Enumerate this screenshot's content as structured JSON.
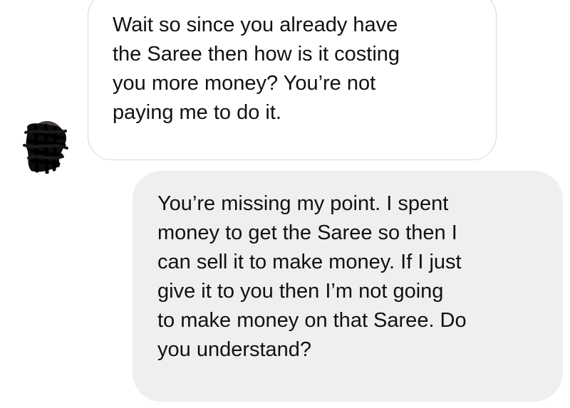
{
  "conversation": {
    "messages": [
      {
        "direction": "incoming",
        "lines": [
          "Wait so since you already have",
          "the Saree then how is it costing",
          "you more money? You’re not",
          "paying me to do it."
        ]
      },
      {
        "direction": "outgoing",
        "lines": [
          "You’re missing my point. I spent",
          "money to get the Saree so then I",
          "can sell it to make money. If I just",
          "give it to you then I’m not going",
          "to make money on that Saree. Do",
          "you understand?"
        ]
      }
    ],
    "avatar": {
      "icon": "redacted-avatar-icon",
      "color": "#111111"
    }
  },
  "colors": {
    "background": "#ffffff",
    "incoming_bubble": "#ffffff",
    "incoming_border": "#d9d9d9",
    "outgoing_bubble": "#efefef",
    "text": "#111111"
  }
}
